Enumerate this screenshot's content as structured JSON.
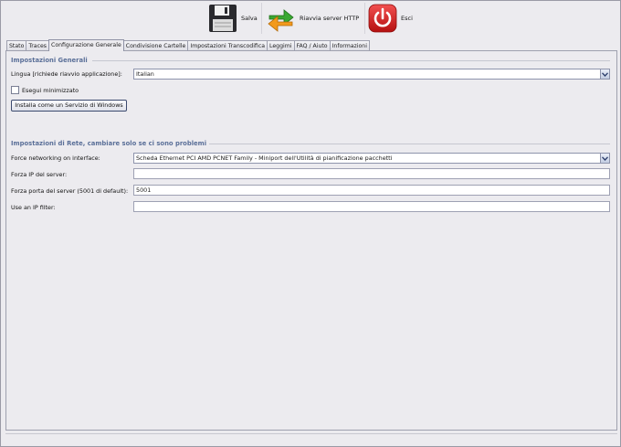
{
  "toolbar": {
    "save_label": "Salva",
    "restart_label": "Riavvia server HTTP",
    "exit_label": "Esci"
  },
  "tabs": [
    {
      "label": "Stato",
      "active": false
    },
    {
      "label": "Traces",
      "active": false
    },
    {
      "label": "Configurazione Generale",
      "active": true
    },
    {
      "label": "Condivisione Cartelle",
      "active": false
    },
    {
      "label": "Impostazioni Transcodifica",
      "active": false
    },
    {
      "label": "Leggimi",
      "active": false
    },
    {
      "label": "FAQ / Aiuto",
      "active": false
    },
    {
      "label": "Informazioni",
      "active": false
    }
  ],
  "general": {
    "title": "Impostazioni Generali",
    "language_label": "Lingua [richiede riavvio applicazione]:",
    "language_value": "Italian",
    "minimized_label": "Esegui minimizzato",
    "minimized_checked": false,
    "service_button": "Installa come un Servizio di Windows"
  },
  "network": {
    "title": "Impostazioni di Rete, cambiare solo se ci sono problemi",
    "interface_label": "Force networking on interface:",
    "interface_value": "Scheda Ethernet PCI AMD PCNET Family - Miniport dell'Utilità di pianificazione pacchetti",
    "ip_label": "Forza IP del server:",
    "ip_value": "",
    "port_label": "Forza porta del server (5001 di default):",
    "port_value": "5001",
    "filter_label": "Use an IP filter:",
    "filter_value": ""
  },
  "colors": {
    "section_title": "#5a6f98",
    "exit_icon": "#d42020",
    "restart_green": "#3aa832",
    "restart_orange": "#f39a1c"
  },
  "icons": {
    "save": "floppy-disk-icon",
    "restart": "refresh-arrows-icon",
    "exit": "power-icon",
    "dropdown": "chevron-down-icon"
  }
}
